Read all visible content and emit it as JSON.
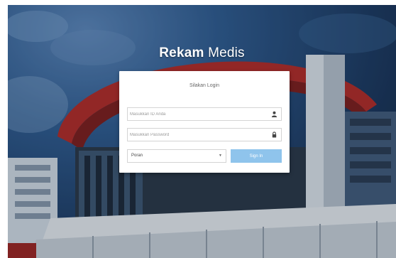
{
  "app": {
    "title_bold": "Rekam",
    "title_light": "Medis"
  },
  "login": {
    "heading": "Silakan Login",
    "user_id_placeholder": "Masukkan ID Anda",
    "user_id_value": "",
    "password_placeholder": "Masukkan Password",
    "password_value": "",
    "role_selected": "Poran",
    "signin_label": "Sign In"
  },
  "icons": {
    "user_field": "user-icon",
    "password_field": "lock-icon",
    "role_select": "caret-down-icon"
  },
  "colors": {
    "signin_button": "#8fc4ec",
    "panel": "#ffffff",
    "title_text": "#ffffff"
  }
}
